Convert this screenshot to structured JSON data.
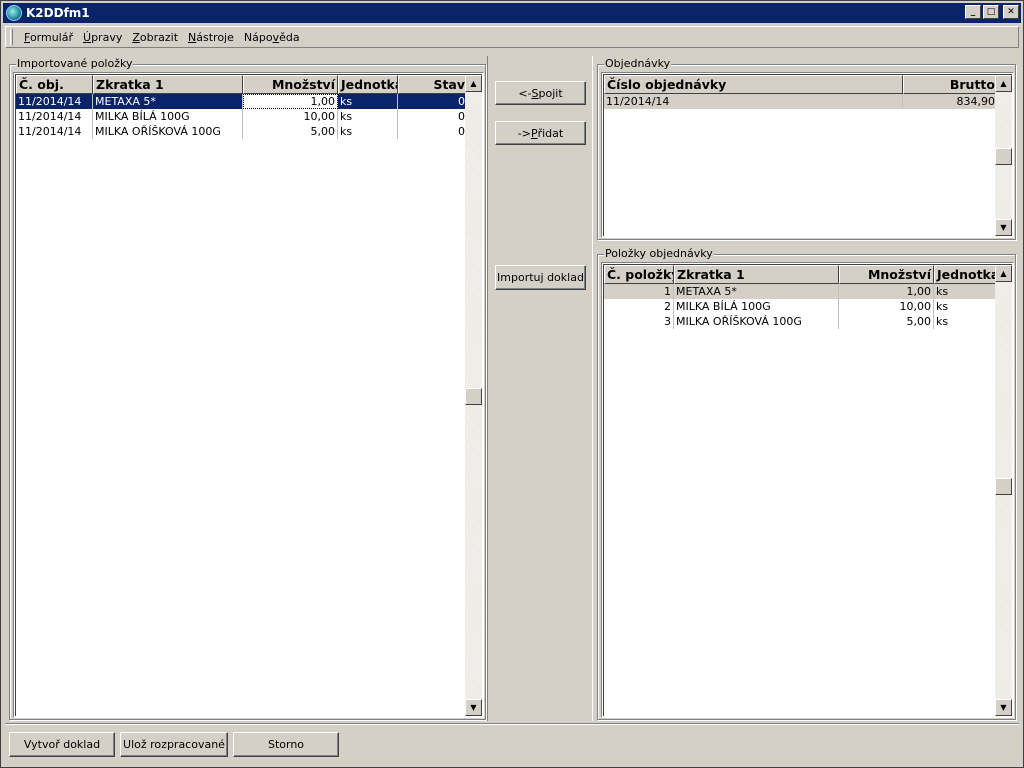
{
  "window": {
    "title": "K2DDfm1",
    "min_label": "_",
    "max_label": "□",
    "close_label": "✕"
  },
  "menu": [
    {
      "pre": "",
      "u": "F",
      "post": "ormulář"
    },
    {
      "pre": "",
      "u": "Ú",
      "post": "pravy"
    },
    {
      "pre": "",
      "u": "Z",
      "post": "obrazit"
    },
    {
      "pre": "",
      "u": "N",
      "post": "ástroje"
    },
    {
      "pre": "Nápo",
      "u": "v",
      "post": "ěda"
    }
  ],
  "imported": {
    "title": "Importované položky",
    "columns": [
      "Č. obj.",
      "Zkratka 1",
      "Množství",
      "Jednotka",
      "Stav"
    ],
    "rows": [
      [
        "11/2014/14",
        "METAXA 5*",
        "1,00",
        "ks",
        "0"
      ],
      [
        "11/2014/14",
        "MILKA BÍLÁ 100G",
        "10,00",
        "ks",
        "0"
      ],
      [
        "11/2014/14",
        "MILKA OŘÍŠKOVÁ 100G",
        "5,00",
        "ks",
        "0"
      ]
    ]
  },
  "middle": {
    "connect": {
      "pre": "<- ",
      "u": "S",
      "post": "pojit"
    },
    "add": {
      "pre": "-> ",
      "u": "P",
      "post": "řidat"
    },
    "import": "Importuj doklad"
  },
  "orders": {
    "title": "Objednávky",
    "columns": [
      "Číslo objednávky",
      "Brutto"
    ],
    "rows": [
      [
        "11/2014/14",
        "834,90"
      ]
    ]
  },
  "order_items": {
    "title": "Položky objednávky",
    "columns": [
      "Č. položky",
      "Zkratka 1",
      "Množství",
      "Jednotka"
    ],
    "rows": [
      [
        "1",
        "METAXA 5*",
        "1,00",
        "ks"
      ],
      [
        "2",
        "MILKA BÍLÁ 100G",
        "10,00",
        "ks"
      ],
      [
        "3",
        "MILKA OŘÍŠKOVÁ 100G",
        "5,00",
        "ks"
      ]
    ]
  },
  "footer": {
    "create": "Vytvoř doklad",
    "save": "Ulož rozpracované",
    "cancel": "Storno"
  },
  "scroll": {
    "up": "▲",
    "down": "▼"
  },
  "colors": {
    "titlebar": "#0a246a",
    "face": "#d4d0c8",
    "selection": "#0a246a"
  }
}
